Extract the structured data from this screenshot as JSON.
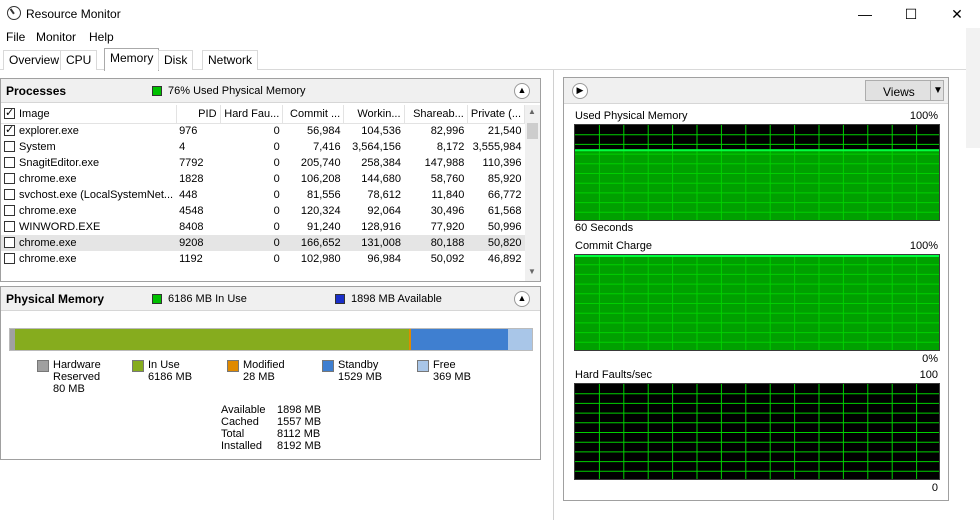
{
  "window": {
    "title": "Resource Monitor",
    "minimize": "—",
    "maximize": "☐",
    "close": "✕"
  },
  "menu": [
    "File",
    "Monitor",
    "Help"
  ],
  "tabs": [
    "Overview",
    "CPU",
    "Memory",
    "Disk",
    "Network"
  ],
  "active_tab": "Memory",
  "processes": {
    "title": "Processes",
    "badge_color": "#00c000",
    "badge_text": "76% Used Physical Memory",
    "columns": [
      "Image",
      "PID",
      "Hard Fau...",
      "Commit ...",
      "Workin...",
      "Shareab...",
      "Private (..."
    ],
    "rows": [
      {
        "image": "explorer.exe",
        "pid": "976",
        "hard": "0",
        "commit": "56,984",
        "working": "104,536",
        "shareable": "82,996",
        "private": "21,540",
        "checked": true,
        "selected": false
      },
      {
        "image": "System",
        "pid": "4",
        "hard": "0",
        "commit": "7,416",
        "working": "3,564,156",
        "shareable": "8,172",
        "private": "3,555,984",
        "checked": false,
        "selected": false
      },
      {
        "image": "SnagitEditor.exe",
        "pid": "7792",
        "hard": "0",
        "commit": "205,740",
        "working": "258,384",
        "shareable": "147,988",
        "private": "110,396",
        "checked": false,
        "selected": false
      },
      {
        "image": "chrome.exe",
        "pid": "1828",
        "hard": "0",
        "commit": "106,208",
        "working": "144,680",
        "shareable": "58,760",
        "private": "85,920",
        "checked": false,
        "selected": false
      },
      {
        "image": "svchost.exe (LocalSystemNet...",
        "pid": "448",
        "hard": "0",
        "commit": "81,556",
        "working": "78,612",
        "shareable": "11,840",
        "private": "66,772",
        "checked": false,
        "selected": false
      },
      {
        "image": "chrome.exe",
        "pid": "4548",
        "hard": "0",
        "commit": "120,324",
        "working": "92,064",
        "shareable": "30,496",
        "private": "61,568",
        "checked": false,
        "selected": false
      },
      {
        "image": "WINWORD.EXE",
        "pid": "8408",
        "hard": "0",
        "commit": "91,240",
        "working": "128,916",
        "shareable": "77,920",
        "private": "50,996",
        "checked": false,
        "selected": false
      },
      {
        "image": "chrome.exe",
        "pid": "9208",
        "hard": "0",
        "commit": "166,652",
        "working": "131,008",
        "shareable": "80,188",
        "private": "50,820",
        "checked": false,
        "selected": true
      },
      {
        "image": "chrome.exe",
        "pid": "1192",
        "hard": "0",
        "commit": "102,980",
        "working": "96,984",
        "shareable": "50,092",
        "private": "46,892",
        "checked": false,
        "selected": false
      }
    ]
  },
  "physical_memory": {
    "title": "Physical Memory",
    "in_use_color": "#00c000",
    "in_use_text": "6186 MB In Use",
    "available_color": "#1a2fc9",
    "available_text": "1898 MB Available",
    "bar": [
      {
        "name": "Hardware Reserved",
        "mb": 80,
        "color": "#a0a0a0"
      },
      {
        "name": "In Use",
        "mb": 6186,
        "color": "#86ac1e"
      },
      {
        "name": "Modified",
        "mb": 28,
        "color": "#e08a00"
      },
      {
        "name": "Standby",
        "mb": 1529,
        "color": "#3f7fd0"
      },
      {
        "name": "Free",
        "mb": 369,
        "color": "#a9c6e8"
      }
    ],
    "legend": [
      {
        "line1": "Hardware",
        "line2": "Reserved",
        "line3": "80 MB",
        "color": "#a0a0a0"
      },
      {
        "line1": "In Use",
        "line2": "6186 MB",
        "line3": "",
        "color": "#86ac1e"
      },
      {
        "line1": "Modified",
        "line2": "28 MB",
        "line3": "",
        "color": "#e08a00"
      },
      {
        "line1": "Standby",
        "line2": "1529 MB",
        "line3": "",
        "color": "#3f7fd0"
      },
      {
        "line1": "Free",
        "line2": "369 MB",
        "line3": "",
        "color": "#a9c6e8"
      }
    ],
    "stats": [
      {
        "label": "Available",
        "value": "1898 MB"
      },
      {
        "label": "Cached",
        "value": "1557 MB"
      },
      {
        "label": "Total",
        "value": "8112 MB"
      },
      {
        "label": "Installed",
        "value": "8192 MB"
      }
    ]
  },
  "graphs": {
    "views_label": "Views",
    "items": [
      {
        "title": "Used Physical Memory",
        "max": "100%",
        "min": "",
        "footer": "60 Seconds",
        "level": 0.75
      },
      {
        "title": "Commit Charge",
        "max": "100%",
        "min": "0%",
        "footer": "",
        "level": 1.0
      },
      {
        "title": "Hard Faults/sec",
        "max": "100",
        "min": "0",
        "footer": "",
        "level": 0.0
      }
    ]
  }
}
